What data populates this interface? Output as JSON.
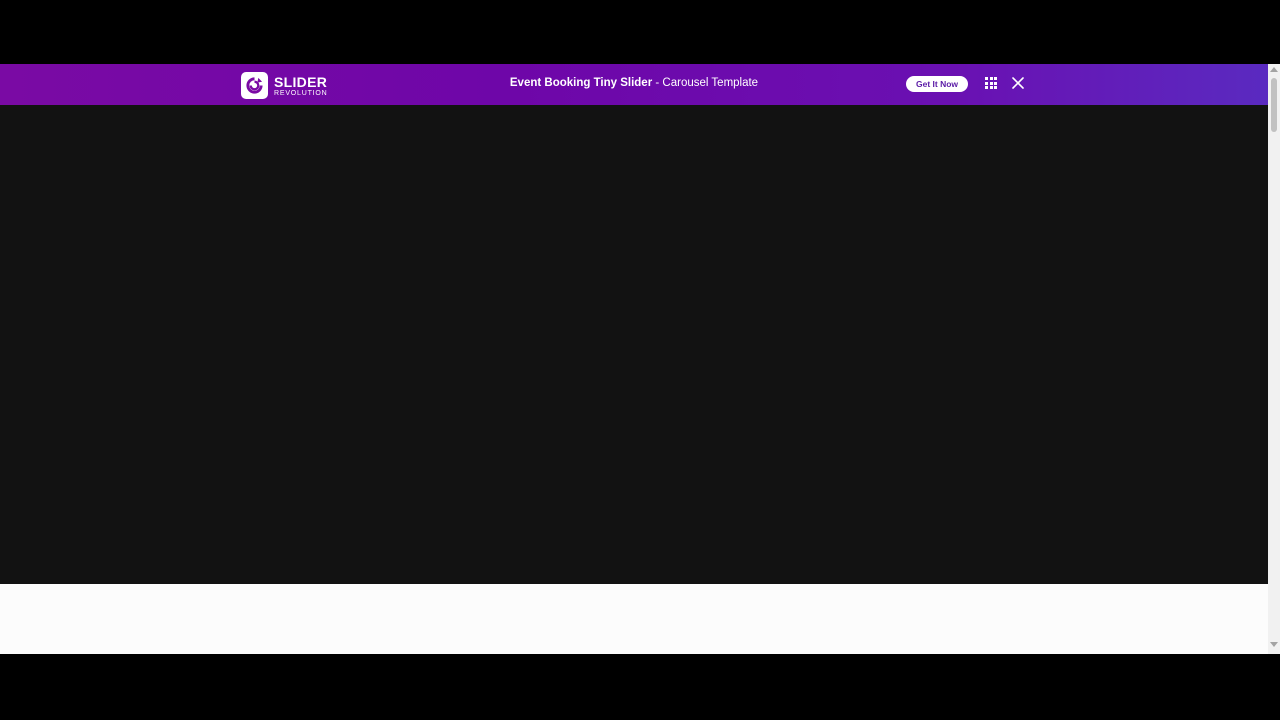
{
  "header": {
    "logo_main": "SLIDER",
    "logo_sub": "REVOLUTION",
    "title_bold": "Event Booking Tiny Slider",
    "title_rest": " - Carousel Template",
    "get_button_label": "Get It Now"
  },
  "icons": {
    "logo": "slider-revolution-logo-icon",
    "apps": "grid-icon",
    "close": "close-icon",
    "scroll_up": "arrow-up-icon",
    "scroll_down": "arrow-down-icon"
  },
  "colors": {
    "header_gradient_start": "#7a0aa4",
    "header_gradient_end": "#5a2ac0",
    "stage_background": "#121212",
    "button_text": "#5a1aa6"
  }
}
